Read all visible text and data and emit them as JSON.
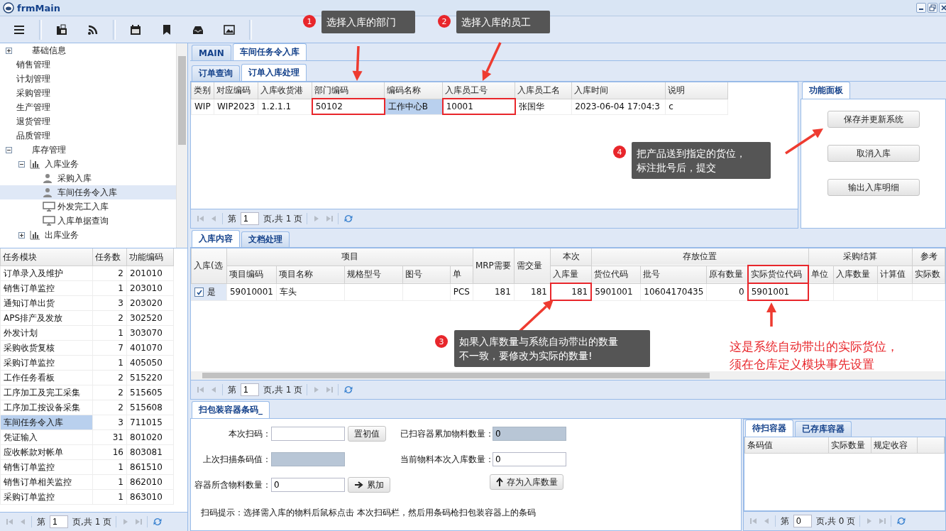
{
  "window": {
    "title": "frmMain"
  },
  "nav_tree": [
    {
      "label": "基础信息",
      "kind": "section",
      "expanded": false,
      "selected": false
    },
    {
      "label": "销售管理",
      "kind": "page",
      "selected": false
    },
    {
      "label": "计划管理",
      "kind": "page",
      "selected": false
    },
    {
      "label": "采购管理",
      "kind": "page",
      "selected": false
    },
    {
      "label": "生产管理",
      "kind": "page",
      "selected": false
    },
    {
      "label": "退货管理",
      "kind": "page",
      "selected": false
    },
    {
      "label": "品质管理",
      "kind": "page",
      "selected": false
    },
    {
      "label": "库存管理",
      "kind": "section",
      "expanded": true,
      "selected": false,
      "children": [
        {
          "label": "入库业务",
          "kind": "group",
          "expanded": true,
          "selected": false,
          "children": [
            {
              "label": "采购入库",
              "kind": "person",
              "selected": false
            },
            {
              "label": "车间任务令入库",
              "kind": "person",
              "selected": true
            },
            {
              "label": "外发完工入库",
              "kind": "monitor",
              "selected": false
            },
            {
              "label": "入库单据查询",
              "kind": "monitor",
              "selected": false
            }
          ]
        },
        {
          "label": "出库业务",
          "kind": "group",
          "expanded": false,
          "selected": false
        }
      ]
    }
  ],
  "task_table": {
    "columns": [
      "任务模块",
      "任务数",
      "功能编码"
    ],
    "rows": [
      {
        "cells": [
          "订单录入及维护",
          "2",
          "201010"
        ],
        "selected": false
      },
      {
        "cells": [
          "销售订单监控",
          "1",
          "203010"
        ],
        "selected": false
      },
      {
        "cells": [
          "通知订单出货",
          "3",
          "203020"
        ],
        "selected": false
      },
      {
        "cells": [
          "APS排产及发放",
          "2",
          "302520"
        ],
        "selected": false
      },
      {
        "cells": [
          "外发计划",
          "1",
          "303070"
        ],
        "selected": false
      },
      {
        "cells": [
          "采购收货复核",
          "7",
          "401070"
        ],
        "selected": false
      },
      {
        "cells": [
          "采购订单监控",
          "1",
          "405050"
        ],
        "selected": false
      },
      {
        "cells": [
          "工作任务看板",
          "2",
          "515220"
        ],
        "selected": false
      },
      {
        "cells": [
          "工序加工及完工采集",
          "2",
          "515605"
        ],
        "selected": false
      },
      {
        "cells": [
          "工序加工按设备采集",
          "2",
          "515608"
        ],
        "selected": false
      },
      {
        "cells": [
          "车间任务令入库",
          "3",
          "711015"
        ],
        "selected": true
      },
      {
        "cells": [
          "凭证输入",
          "31",
          "801020"
        ],
        "selected": false
      },
      {
        "cells": [
          "应收帐款对帐单",
          "16",
          "803081"
        ],
        "selected": false
      },
      {
        "cells": [
          "销售订单监控",
          "1",
          "861510"
        ],
        "selected": false
      },
      {
        "cells": [
          "销售订单相关监控",
          "1",
          "862010"
        ],
        "selected": false
      },
      {
        "cells": [
          "采购订单监控",
          "1",
          "863010"
        ],
        "selected": false
      }
    ],
    "pager": {
      "prefix": "第",
      "page": "1",
      "suffix": "页,共 1 页"
    }
  },
  "tabs": [
    {
      "label": "MAIN",
      "selected": false
    },
    {
      "label": "车间任务令入库",
      "selected": true
    }
  ],
  "sub_tabs": [
    {
      "label": "订单查询",
      "selected": false
    },
    {
      "label": "订单入库处理",
      "selected": true
    }
  ],
  "order_grid": {
    "columns": [
      "类别",
      "对应编码",
      "入库收货港",
      "部门编码",
      "编码名称",
      "入库员工号",
      "入库员工名",
      "入库时间",
      "说明"
    ],
    "rows": [
      {
        "cells": [
          {
            "text": "WIP",
            "selected": false,
            "highlighted": false
          },
          {
            "text": "WIP2023",
            "selected": false,
            "highlighted": false
          },
          {
            "text": "1.2.1.1",
            "selected": false,
            "highlighted": false
          },
          {
            "text": "50102",
            "selected": false,
            "highlighted": true
          },
          {
            "text": "工作中心B",
            "selected": true,
            "highlighted": false
          },
          {
            "text": "10001",
            "selected": false,
            "highlighted": true
          },
          {
            "text": "张国华",
            "selected": false,
            "highlighted": false
          },
          {
            "text": "2023-06-04 17:04:3",
            "selected": false,
            "highlighted": false
          },
          {
            "text": "c",
            "selected": false,
            "highlighted": false
          }
        ]
      }
    ],
    "pager": {
      "prefix": "第",
      "page": "1",
      "suffix": "页,共 1 页"
    }
  },
  "function_panel": {
    "tab": "功能面板",
    "buttons": [
      "保存并更新系统",
      "取消入库",
      "输出入库明细"
    ]
  },
  "content_tabs": [
    {
      "label": "入库内容",
      "selected": true
    },
    {
      "label": "文档处理",
      "selected": false
    }
  ],
  "content_grid": {
    "groups": [
      {
        "label": "入库(选"
      },
      {
        "label": "项目",
        "columns": [
          {
            "label": "项目编码",
            "highlighted": false
          },
          {
            "label": "项目名称",
            "highlighted": false
          },
          {
            "label": "规格型号",
            "highlighted": false
          },
          {
            "label": "图号",
            "highlighted": false
          },
          {
            "label": "单",
            "highlighted": false
          }
        ]
      },
      {
        "label": "MRP需要"
      },
      {
        "label": "需交量"
      },
      {
        "label": "本次",
        "columns": [
          {
            "label": "入库量",
            "highlighted": false
          }
        ]
      },
      {
        "label": "存放位置",
        "columns": [
          {
            "label": "货位代码",
            "highlighted": false
          },
          {
            "label": "批号",
            "highlighted": false
          },
          {
            "label": "原有数量",
            "highlighted": false
          },
          {
            "label": "实际货位代码",
            "highlighted": true
          }
        ]
      },
      {
        "label": "采购结算",
        "columns": [
          {
            "label": "单位",
            "highlighted": false
          },
          {
            "label": "入库数量",
            "highlighted": false
          },
          {
            "label": "计算值",
            "highlighted": false
          }
        ]
      },
      {
        "label": "参考",
        "columns": [
          {
            "label": "实际数",
            "highlighted": false
          }
        ]
      }
    ],
    "rows": [
      {
        "checked": true,
        "check_label": "是",
        "cells": [
          {
            "text": "59010001",
            "highlighted": false
          },
          {
            "text": "车头",
            "highlighted": false
          },
          null,
          null,
          {
            "text": "PCS",
            "highlighted": false
          },
          {
            "text": "181",
            "highlighted": false
          },
          {
            "text": "181",
            "highlighted": false
          },
          {
            "text": "181",
            "highlighted": true
          },
          {
            "text": "5901001",
            "highlighted": false
          },
          {
            "text": "10604170435",
            "highlighted": false
          },
          {
            "text": "0",
            "highlighted": false
          },
          {
            "text": "5901001",
            "highlighted": true
          },
          null,
          null,
          null,
          null
        ]
      }
    ],
    "pager": {
      "prefix": "第",
      "page": "1",
      "suffix": "页,共 1 页"
    }
  },
  "scan_tab": {
    "label": "扫包装容器条码_",
    "selected": true
  },
  "scan_form": {
    "left_fields": [
      {
        "label": "本次扫码：",
        "disabled": false,
        "button": {
          "label": "置初值",
          "kind": "plain"
        }
      },
      {
        "label": "上次扫描条码值：",
        "disabled": true
      },
      {
        "label": "容器所含物料数量：",
        "value": "0",
        "disabled": false,
        "button": {
          "label": "累加",
          "kind": "add"
        }
      }
    ],
    "right_fields": [
      {
        "label": "已扫容器累加物料数量：",
        "value": "0",
        "disabled": true
      },
      {
        "label": "当前物料本次入库数量：",
        "value": "0",
        "disabled": false
      }
    ],
    "save_button": "存为入库数量",
    "hint": "扫码提示：选择需入库的物料后鼠标点击 本次扫码栏，然后用条码枪扫包装容器上的条码"
  },
  "container_panel": {
    "tabs": [
      {
        "label": "待扫容器",
        "selected": true
      },
      {
        "label": "已存库容器",
        "selected": false
      }
    ],
    "columns": [
      "条码值",
      "实际数量",
      "规定收容"
    ],
    "pager": {
      "prefix": "第",
      "page": "0",
      "suffix": "页,共 0 页"
    }
  },
  "callouts": [
    {
      "number": "1",
      "lines": [
        "选择入库的部门"
      ]
    },
    {
      "number": "2",
      "lines": [
        "选择入库的员工"
      ]
    },
    {
      "number": "4",
      "lines": [
        "把产品送到指定的货位，",
        "标注批号后，提交"
      ]
    },
    {
      "number": "3",
      "lines": [
        "如果入库数量与系统自动带出的数量",
        "不一致，要修改为实际的数量!"
      ]
    }
  ],
  "note": {
    "lines": [
      "这是系统自动带出的实际货位，",
      "须在仓库定义模块事先设置"
    ]
  }
}
